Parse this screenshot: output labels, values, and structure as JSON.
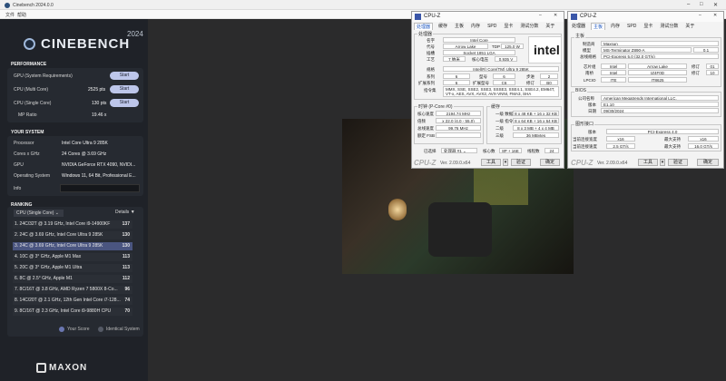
{
  "cinebench": {
    "window_title": "Cinebench 2024.0.0",
    "menu": [
      "文件",
      "帮助"
    ],
    "brand": "CINEBENCH",
    "version": "2024",
    "performance_title": "PERFORMANCE",
    "perf_rows": [
      {
        "label": "GPU (System Requirements)",
        "value": "",
        "button": "Start"
      },
      {
        "label": "CPU (Multi Core)",
        "value": "2525 pts",
        "button": "Start"
      },
      {
        "label": "CPU (Single Core)",
        "value": "130 pts",
        "button": "Start"
      },
      {
        "label": "MP Ratio",
        "value": "19.46 x",
        "button": ""
      }
    ],
    "system_title": "YOUR SYSTEM",
    "system_rows": [
      {
        "label": "Processor",
        "value": "Intel Core Ultra 9 285K"
      },
      {
        "label": "Cores x GHz",
        "value": "24 Cores @ 3.69 GHz"
      },
      {
        "label": "GPU",
        "value": "NVIDIA GeForce RTX 4090, NVIDI..."
      },
      {
        "label": "Operating System",
        "value": "Windows 11, 64 Bit, Professional E..."
      },
      {
        "label": "Info",
        "value": ""
      }
    ],
    "ranking_title": "RANKING",
    "ranking_dropdown": "CPU (Single Core)",
    "details_label": "Details",
    "ranking": [
      {
        "name": "1. 24C/32T @ 3.19 GHz, Intel Core i9-14900KF",
        "score": "137",
        "highlight": false
      },
      {
        "name": "2. 24C @ 3.69 GHz, Intel Core Ultra 9 285K",
        "score": "130",
        "highlight": false
      },
      {
        "name": "3. 24C @ 3.69 GHz, Intel Core Ultra 9 285K",
        "score": "130",
        "highlight": true
      },
      {
        "name": "4. 10C @ 3° GHz, Apple M1 Max",
        "score": "113",
        "highlight": false
      },
      {
        "name": "5. 20C @ 3° GHz, Apple M1 Ultra",
        "score": "113",
        "highlight": false
      },
      {
        "name": "6. 8C @ 2.5° GHz, Apple M1",
        "score": "112",
        "highlight": false
      },
      {
        "name": "7. 8C/16T @ 3.8 GHz, AMD Ryzen 7 5800X 8-Co...",
        "score": "96",
        "highlight": false
      },
      {
        "name": "8. 14C/20T @ 2.1 GHz, 12th Gen Intel Core i7-128...",
        "score": "74",
        "highlight": false
      },
      {
        "name": "9. 8C/16T @ 2.3 GHz, Intel Core i9-9880H CPU",
        "score": "70",
        "highlight": false
      }
    ],
    "legend_your_score": "Your Score",
    "legend_identical": "Identical System",
    "footer_brand": "MAXON"
  },
  "cpuz1": {
    "title": "CPU-Z",
    "tabs": [
      "处理器",
      "缓存",
      "主板",
      "内存",
      "SPD",
      "显卡",
      "测试分数",
      "关于"
    ],
    "group_processor": "处理器",
    "labels": {
      "name": "名字",
      "codename": "代号",
      "package": "插槽",
      "tech": "工艺",
      "spec": "规格",
      "family": "系列",
      "ext_family": "扩展系列",
      "instructions": "指令集",
      "tdp": "TDP",
      "vcore": "核心电压",
      "model": "型号",
      "ext_model": "扩展型号",
      "stepping": "步进",
      "revision": "修订"
    },
    "values": {
      "name": "Intel Core",
      "codename": "Arrow Lake",
      "tdp": "125.0 W",
      "package": "Socket 1851 LGA",
      "tech": "7 纳米",
      "vcore": "0.935 V",
      "spec": "Intel(R) Core(TM) Ultra 9 285K",
      "family": "6",
      "model": "6",
      "stepping": "2",
      "ext_family": "6",
      "ext_model": "C6",
      "revision": "B0",
      "instructions": "MMX, SSE, SSE2, SSE3, SSSE3, SSE4.1, SSE4.2, EM64T, VT-x, AES, AVX, AVX2, AVX-VNNI, FMA3, SHA"
    },
    "intel_logo": "intel",
    "clock_group": "时钟 (P-Core #0)",
    "clock_labels": {
      "core": "核心速度",
      "mult": "倍频",
      "bus": "总线速度",
      "fsb": "额定 FSB"
    },
    "clock_values": {
      "core": "2194.74 MHz",
      "mult": "x 22.0 (4.0 - 55.0)",
      "bus": "99.76 MHz",
      "fsb": ""
    },
    "cache_group": "缓存",
    "cache_labels": {
      "l1d": "一级 数据",
      "l1i": "一级 指令",
      "l2": "二级",
      "l3": "三级"
    },
    "cache_values": {
      "l1d": "8 x 48 KB + 16 x 32 KB",
      "l1i": "8 x 64 KB + 16 x 64 KB",
      "l2": "8 x 3 MB + 4 x 4 MB",
      "l3": "36 MBytes"
    },
    "selected_label": "已选择",
    "selected_value": "处理器 #1",
    "cores_label": "核心数",
    "cores_value": "8P + 16E",
    "threads_label": "线程数",
    "threads_value": "24",
    "brand": "CPU-Z",
    "version": "Ver. 2.09.0.x64",
    "tools_button": "工具",
    "validate_button": "验证",
    "ok_button": "确定"
  },
  "cpuz2": {
    "title": "CPU-Z",
    "tabs": [
      "处理器",
      "主板",
      "内存",
      "SPD",
      "显卡",
      "测试分数",
      "关于"
    ],
    "group_mb": "主板",
    "labels": {
      "maker": "制造商",
      "model": "模型",
      "bus": "总线规格",
      "chipset": "芯片组",
      "southbridge": "南桥",
      "lpcio": "LPCIO",
      "rev": "修订"
    },
    "values": {
      "maker": "Maxsun",
      "model": "MS-Terminator Z890-A",
      "model_rev": "0.1",
      "bus": "PCI-Express 5.0 (32.0 GT/s)",
      "chipset_vendor": "Intel",
      "chipset_name": "Arrow Lake",
      "chipset_rev": "01",
      "sb_vendor": "Intel",
      "sb_name": "IZ4F0D",
      "sb_rev": "10",
      "lpcio_vendor": "ITE",
      "lpcio_name": "IT8625"
    },
    "group_bios": "BIOS",
    "bios_labels": {
      "brand": "公司名称",
      "version": "版本",
      "date": "日期"
    },
    "bios_values": {
      "brand": "American Megatrends International LLC.",
      "version": "E1.10",
      "date": "09/30/2024"
    },
    "group_gfx": "图形接口",
    "gfx_labels": {
      "version": "版本",
      "link_width": "当前连接宽度",
      "link_speed": "当前连接速度",
      "max_width": "最大支持",
      "max_speed": "最大支持"
    },
    "gfx_values": {
      "version": "PCI-Express 4.0",
      "link_width": "x16",
      "link_speed": "2.5 GT/s",
      "max_width": "x16",
      "max_speed": "16.0 GT/s"
    },
    "brand": "CPU-Z",
    "version": "Ver. 2.09.0.x64",
    "tools_button": "工具",
    "validate_button": "验证",
    "ok_button": "确定"
  }
}
